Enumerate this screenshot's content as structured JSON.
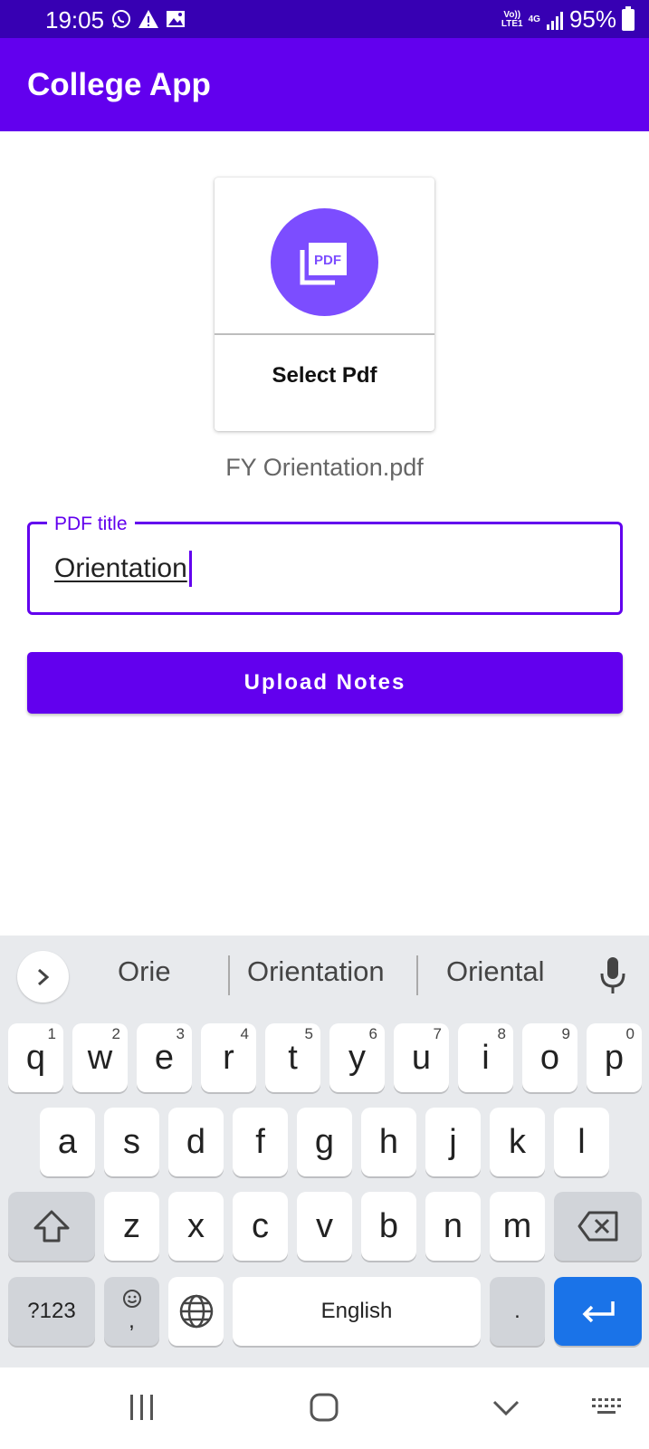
{
  "status_bar": {
    "time": "19:05",
    "network_top": "Vo))",
    "network_bottom": "LTE1",
    "network_gen": "4G",
    "battery": "95%",
    "icons": [
      "whatsapp-icon",
      "alert-icon",
      "image-icon",
      "signal-icon",
      "battery-icon"
    ]
  },
  "app_bar": {
    "title": "College App"
  },
  "pdf_picker": {
    "label": "Select Pdf",
    "icon": "pdf-icon",
    "accent": "#7c4dff"
  },
  "file": {
    "name": "FY Orientation.pdf"
  },
  "title_field": {
    "label": "PDF title",
    "value": "Orientation"
  },
  "upload_button": {
    "label": "Upload Notes"
  },
  "keyboard": {
    "suggestions": [
      "Orie",
      "Orientation",
      "Oriental"
    ],
    "row1": [
      {
        "key": "q",
        "hint": "1"
      },
      {
        "key": "w",
        "hint": "2"
      },
      {
        "key": "e",
        "hint": "3"
      },
      {
        "key": "r",
        "hint": "4"
      },
      {
        "key": "t",
        "hint": "5"
      },
      {
        "key": "y",
        "hint": "6"
      },
      {
        "key": "u",
        "hint": "7"
      },
      {
        "key": "i",
        "hint": "8"
      },
      {
        "key": "o",
        "hint": "9"
      },
      {
        "key": "p",
        "hint": "0"
      }
    ],
    "row2": [
      "a",
      "s",
      "d",
      "f",
      "g",
      "h",
      "j",
      "k",
      "l"
    ],
    "row3": [
      "z",
      "x",
      "c",
      "v",
      "b",
      "n",
      "m"
    ],
    "symbols_key": "?123",
    "comma_key": ",",
    "space_key": "English",
    "period_key": "."
  },
  "colors": {
    "primary": "#6200ee",
    "primary_dark": "#3700b3",
    "enter_key": "#1a73e8"
  }
}
